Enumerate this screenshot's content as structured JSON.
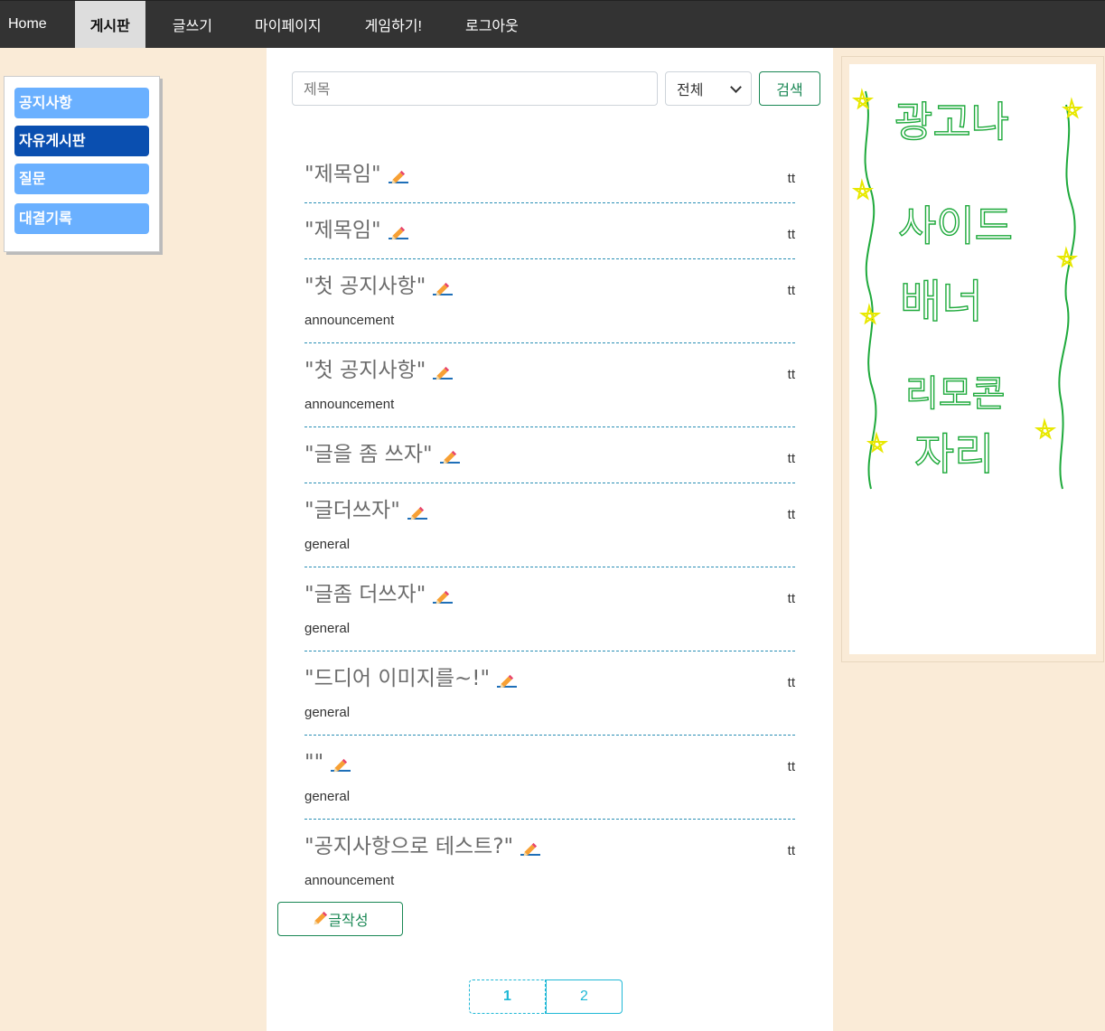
{
  "nav": {
    "items": [
      {
        "label": "Home"
      },
      {
        "label": "게시판"
      },
      {
        "label": "글쓰기"
      },
      {
        "label": "마이페이지"
      },
      {
        "label": "게임하기!"
      },
      {
        "label": "로그아웃"
      }
    ],
    "active_index": 1
  },
  "sidebar": {
    "items": [
      {
        "label": "공지사항"
      },
      {
        "label": "자유게시판"
      },
      {
        "label": "질문"
      },
      {
        "label": "대결기록"
      }
    ],
    "active_index": 1
  },
  "search": {
    "placeholder": "제목",
    "select_value": "전체",
    "button_label": "검색"
  },
  "posts": [
    {
      "title": "\"제목임\"",
      "author": "tt",
      "category": ""
    },
    {
      "title": "\"제목임\"",
      "author": "tt",
      "category": ""
    },
    {
      "title": "\"첫 공지사항\"",
      "author": "tt",
      "category": "announcement"
    },
    {
      "title": "\"첫 공지사항\"",
      "author": "tt",
      "category": "announcement"
    },
    {
      "title": "\"글을 좀 쓰자\"",
      "author": "tt",
      "category": ""
    },
    {
      "title": "\"글더쓰자\"",
      "author": "tt",
      "category": "general"
    },
    {
      "title": "\"글좀 더쓰자\"",
      "author": "tt",
      "category": "general"
    },
    {
      "title": "\"드디어 이미지를~!\"",
      "author": "tt",
      "category": "general"
    },
    {
      "title": "\"\"",
      "author": "tt",
      "category": "general"
    },
    {
      "title": "\"공지사항으로 테스트?\"",
      "author": "tt",
      "category": "announcement"
    }
  ],
  "write_button": {
    "label": "글작성"
  },
  "pagination": {
    "pages": [
      "1",
      "2"
    ],
    "active": "1"
  },
  "ad": {
    "lines": [
      "광고나",
      "사이드",
      "배너",
      "리모콘",
      "자리"
    ],
    "colors": {
      "text": "#1faa3c",
      "stars": "#e8e800"
    }
  },
  "colors": {
    "background": "#faebd7",
    "nav_bg": "#333333",
    "sidebar_item": "#6ab0ff",
    "sidebar_active": "#0a4fb0",
    "success": "#198754",
    "page_accent": "#1fb8d6"
  }
}
